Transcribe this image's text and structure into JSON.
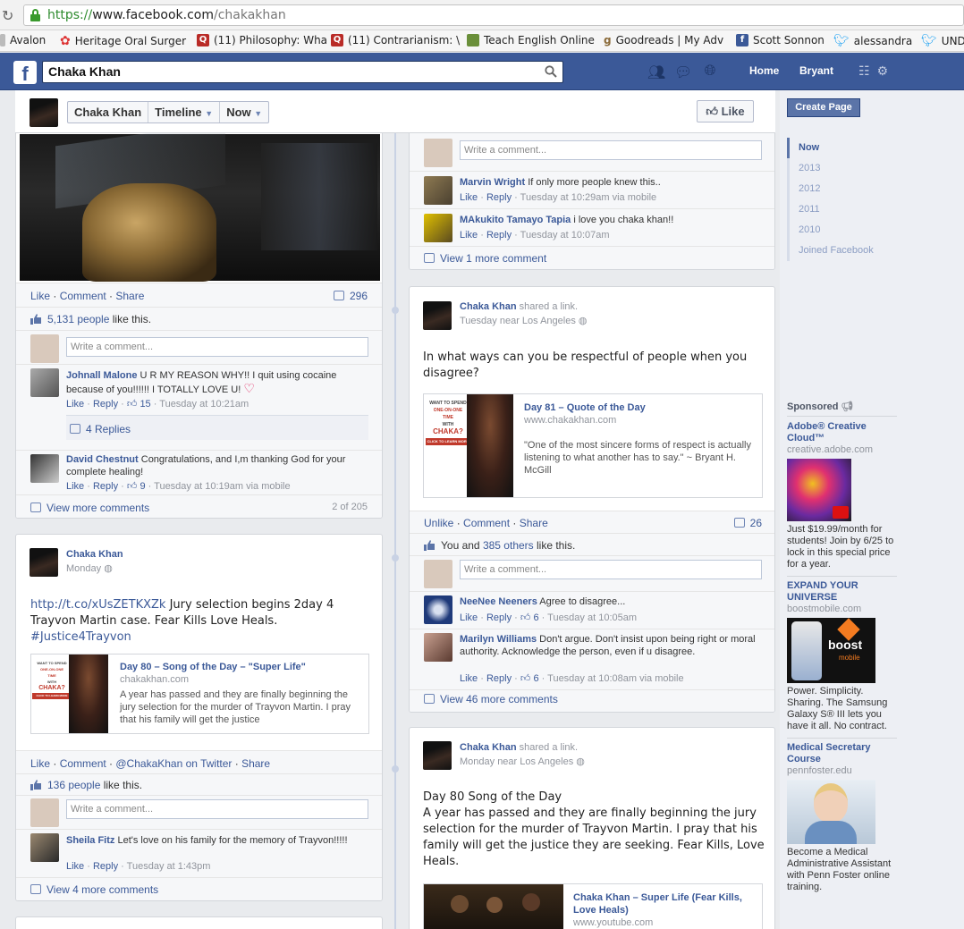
{
  "browser": {
    "url_proto": "https://",
    "url_host": "www.facebook.com",
    "url_path": "/chakakhan",
    "bookmarks": [
      {
        "label": "Avalon"
      },
      {
        "label": "Heritage Oral Surger"
      },
      {
        "label": "(11) Philosophy: Wha"
      },
      {
        "label": "(11) Contrarianism: \\"
      },
      {
        "label": "Teach English Online"
      },
      {
        "label": "Goodreads | My Adv"
      },
      {
        "label": "Scott Sonnon"
      },
      {
        "label": "alessandra"
      },
      {
        "label": "UNDF"
      }
    ]
  },
  "fb": {
    "logo": "f",
    "search_value": "Chaka Khan",
    "nav_home": "Home",
    "nav_user": "Bryant"
  },
  "page_header": {
    "name": "Chaka Khan",
    "timeline": "Timeline",
    "now": "Now",
    "like": "Like"
  },
  "left_post1": {
    "actions": [
      "Like",
      "Comment",
      "Share"
    ],
    "comment_count": "296",
    "likes_count": "5,131 people",
    "likes_suffix": " like this.",
    "write_comment": "Write a comment...",
    "comments": [
      {
        "name": "Johnall Malone",
        "text": "U R MY REASON WHY!! I quit using cocaine because of you!!!!!! I TOTALLY LOVE U!",
        "likes": "15",
        "time": "Tuesday at 10:21am",
        "replies": "4 Replies"
      },
      {
        "name": "David Chestnut",
        "text": "Congratulations, and I,m thanking God for your complete healing!",
        "likes": "9",
        "time": "Tuesday at 10:19am via mobile"
      }
    ],
    "view_more": "View more comments",
    "paging": "2 of 205"
  },
  "left_post2": {
    "author": "Chaka Khan",
    "time": "Monday",
    "link": "http://t.co/xUsZETKXZk",
    "text": " Jury selection begins 2day 4 Trayvon Martin case. Fear Kills Love Heals.",
    "hashtag": "#Justice4Trayvon",
    "attachment_title": "Day 80 – Song of the Day – \"Super Life\"",
    "attachment_domain": "chakakhan.com",
    "attachment_desc": "A year has passed and they are finally beginning the jury selection for the murder of Trayvon Martin.  I pray that his family will get the justice",
    "actions": [
      "Like",
      "Comment",
      "@ChakaKhan on Twitter",
      "Share"
    ],
    "likes_count": "136 people",
    "likes_suffix": " like this.",
    "write_comment": "Write a comment...",
    "comment": {
      "name": "Sheila Fitz",
      "text": "Let's love on his family for the memory of Trayvon!!!!!",
      "time": "Tuesday at 1:43pm"
    },
    "view_more": "View 4 more comments"
  },
  "right_post0": {
    "write_comment": "Write a comment...",
    "comments": [
      {
        "name": "Marvin Wright",
        "text": "If only more people knew this..",
        "time": "Tuesday at 10:29am via mobile"
      },
      {
        "name": "MAkukito Tamayo Tapia",
        "text": "i love you chaka khan!!",
        "time": "Tuesday at 10:07am"
      }
    ],
    "view_more": "View 1 more comment"
  },
  "right_post1": {
    "author": "Chaka Khan",
    "shared": " shared a link.",
    "time": "Tuesday near Los Angeles",
    "text": "In what ways can you be respectful of people when you disagree?",
    "attachment_title": "Day 81 – Quote of the Day",
    "attachment_domain": "www.chakakhan.com",
    "attachment_desc": "\"One of the most sincere forms of respect is actually listening to what another has to say.\" ~ Bryant H. McGill",
    "actions": [
      "Unlike",
      "Comment",
      "Share"
    ],
    "comment_count": "26",
    "likes_you": "You and ",
    "likes_others": "385 others",
    "likes_suffix": " like this.",
    "write_comment": "Write a comment...",
    "comments": [
      {
        "name": "NeeNee Neeners",
        "text": "Agree to disagree...",
        "likes": "6",
        "time": "Tuesday at 10:05am"
      },
      {
        "name": "Marilyn Williams",
        "text": "Don't argue. Don't insist upon being right or moral authority. Acknowledge the person, even if u disagree.",
        "likes": "6",
        "time": "Tuesday at 10:08am via mobile"
      }
    ],
    "view_more": "View 46 more comments"
  },
  "right_post2": {
    "author": "Chaka Khan",
    "shared": " shared a link.",
    "time": "Monday near Los Angeles",
    "text_line1": "Day 80 Song of the Day",
    "text_body": "A year has passed and they are finally beginning the jury selection for the murder of Trayvon Martin. I pray that his family will get the justice they are seeking. Fear Kills, Love Heals.",
    "attachment_title": "Chaka Khan – Super Life (Fear Kills, Love Heals)",
    "attachment_domain": "www.youtube.com"
  },
  "thumb_ad": {
    "line1": "WANT TO SPEND",
    "line2": "ONE-ON-ONE",
    "line3": "TIME",
    "line4": "WITH",
    "line5": "CHAKA?",
    "button": "CLICK TO LEARN MORE"
  },
  "right_col": {
    "create_page": "Create Page",
    "years": [
      "Now",
      "2013",
      "2012",
      "2011",
      "2010",
      "Joined Facebook"
    ],
    "sponsored": "Sponsored",
    "ads": [
      {
        "title": "Adobe® Creative Cloud™",
        "url": "creative.adobe.com",
        "body": "Just $19.99/month for students! Join by 6/25 to lock in this special price for a year."
      },
      {
        "title": "EXPAND YOUR UNIVERSE",
        "url": "boostmobile.com",
        "body": "Power. Simplicity. Sharing. The Samsung Galaxy S® III lets you have it all. No contract.",
        "logo": "boost",
        "logo_sub": "mobile"
      },
      {
        "title": "Medical Secretary Course",
        "url": "pennfoster.edu",
        "body": "Become a Medical Administrative Assistant with Penn Foster online training."
      }
    ]
  },
  "colors": {
    "fb_blue": "#3b5998",
    "link": "#3b5998",
    "heart": "#e0245e"
  }
}
